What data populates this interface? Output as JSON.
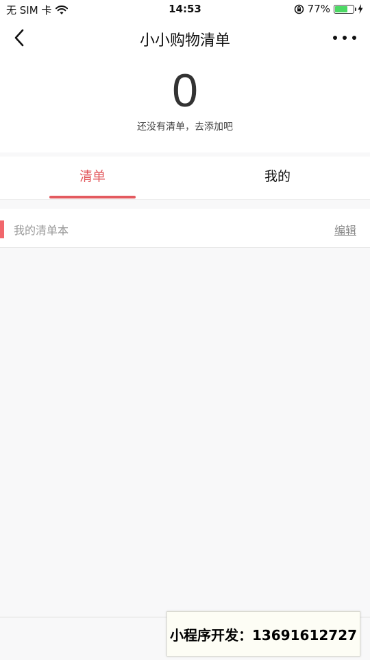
{
  "status_bar": {
    "carrier": "无 SIM 卡",
    "time": "14:53",
    "battery_percent": "77%",
    "battery_level": 0.77,
    "wifi_icon": "wifi-icon",
    "rotation_lock_icon": "rotation-lock-icon",
    "charging_icon": "bolt-icon"
  },
  "nav": {
    "title": "小小购物清单",
    "back_icon": "chevron-left-icon",
    "more_icon": "more-horizontal-icon"
  },
  "summary": {
    "count": "0",
    "hint": "还没有清单，去添加吧"
  },
  "tabs": [
    {
      "label": "清单",
      "active": true
    },
    {
      "label": "我的",
      "active": false
    }
  ],
  "list": {
    "title": "我的清单本",
    "edit_label": "编辑"
  },
  "contact": {
    "text": "小程序开发：13691612727"
  },
  "colors": {
    "accent": "#e35a5f",
    "battery": "#4cd964",
    "background": "#f8f8f9"
  }
}
